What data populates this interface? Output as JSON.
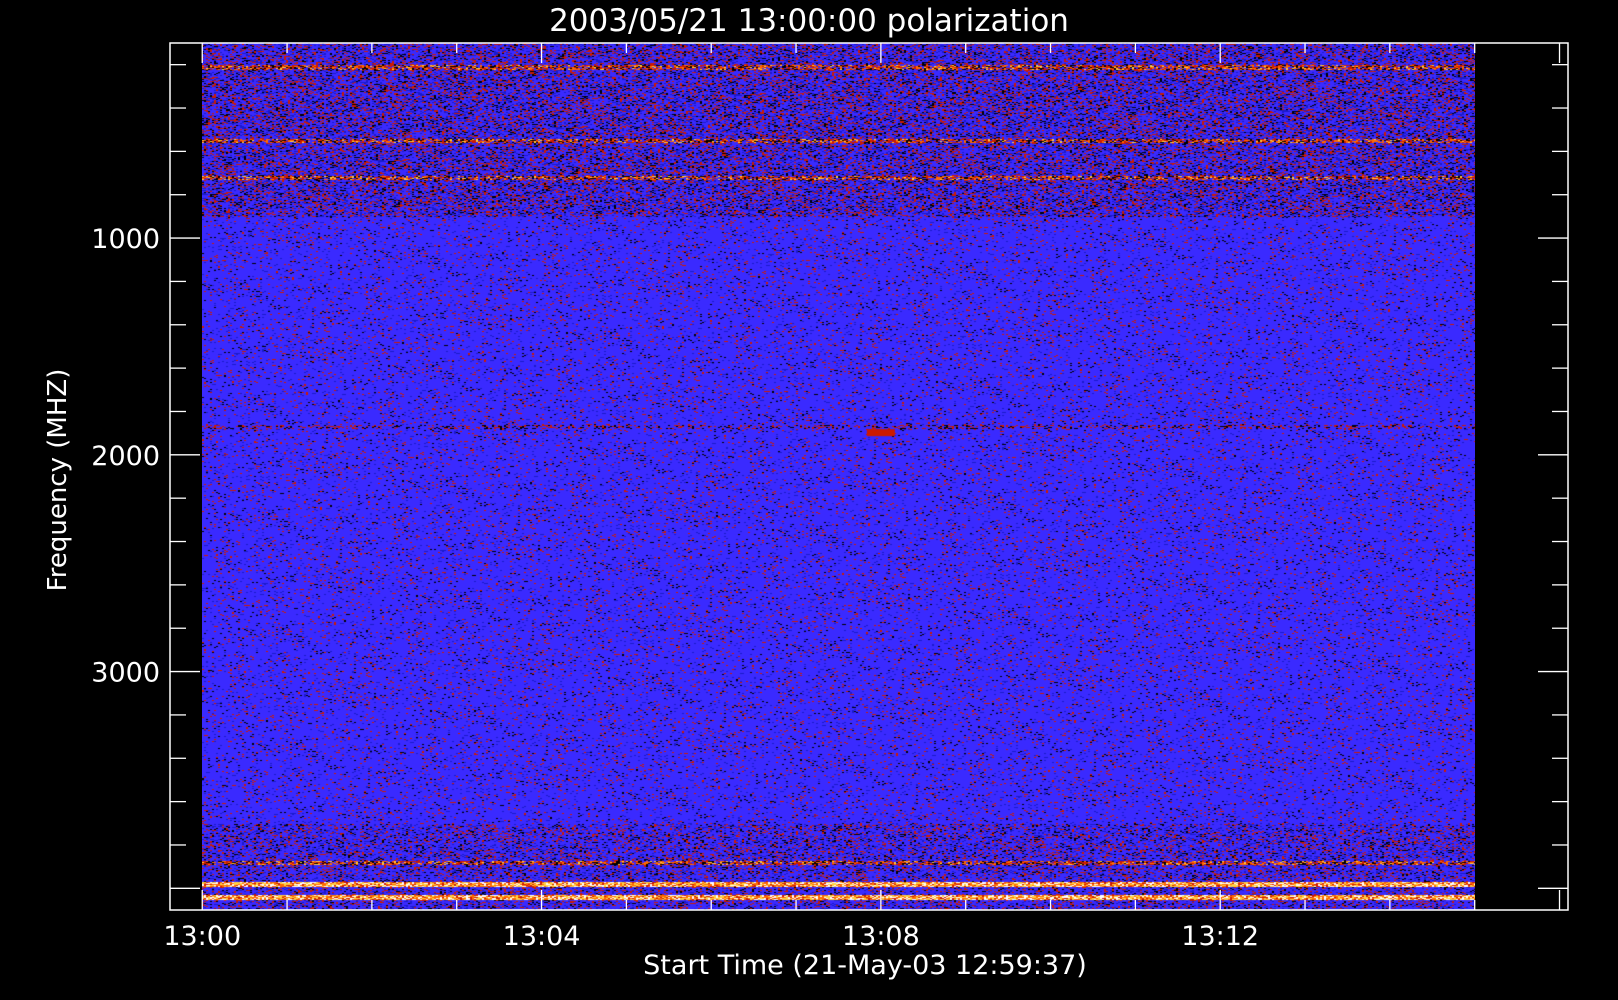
{
  "chart_data": {
    "type": "heatmap",
    "title": "2003/05/21 13:00:00 polarization",
    "xlabel": "Start Time (21-May-03 12:59:37)",
    "ylabel": "Frequency (MHZ)",
    "x_tick_labels": [
      "13:00",
      "13:04",
      "13:08",
      "13:12"
    ],
    "x_ticks_minutes": [
      0,
      4,
      8,
      12
    ],
    "x_range_minutes": [
      -0.38,
      16.1
    ],
    "y_tick_labels": [
      "1000",
      "2000",
      "3000"
    ],
    "y_ticks_mhz": [
      1000,
      2000,
      3000
    ],
    "y_range_mhz": [
      100,
      4100
    ],
    "y_reversed": true,
    "data_time_range_minutes": [
      0,
      15.0
    ],
    "data_freq_range_mhz": [
      100,
      4100
    ],
    "colormap": [
      "#000000",
      "#1a1acc",
      "#3a2aff",
      "#cc1a00",
      "#ff6a00",
      "#ffd040",
      "#ffffff"
    ],
    "background_color": "#000000",
    "foreground_color": "#ffffff",
    "features": [
      {
        "kind": "band",
        "freq_mhz": 210,
        "intensity": "hot"
      },
      {
        "kind": "band",
        "freq_mhz": 550,
        "intensity": "hot"
      },
      {
        "kind": "band",
        "freq_mhz": 720,
        "intensity": "hot"
      },
      {
        "kind": "band",
        "freq_mhz": 1870,
        "intensity": "warm"
      },
      {
        "kind": "band",
        "freq_mhz": 3880,
        "intensity": "hot"
      },
      {
        "kind": "band",
        "freq_mhz": 3980,
        "intensity": "very-hot"
      },
      {
        "kind": "band",
        "freq_mhz": 4040,
        "intensity": "very-hot"
      },
      {
        "kind": "blob",
        "time_minutes": 8.0,
        "freq_mhz": 1900,
        "intensity": "hot"
      }
    ]
  }
}
